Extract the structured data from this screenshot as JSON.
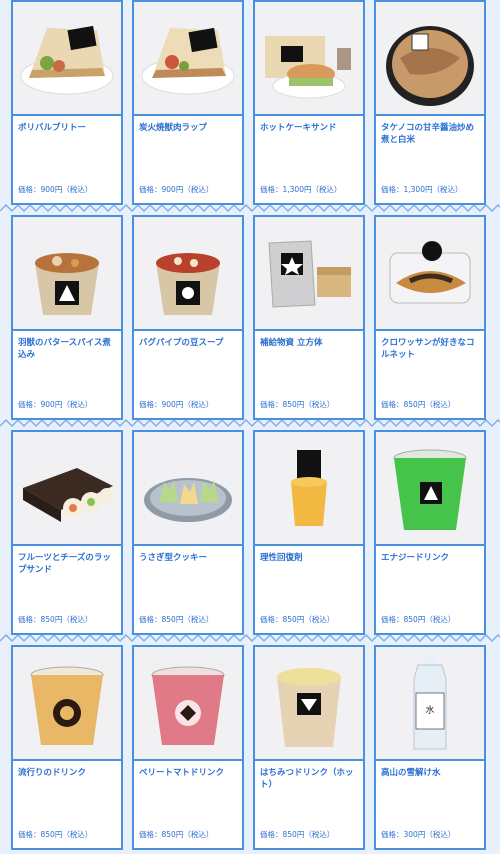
{
  "colors": {
    "accent": "#2b6fd1",
    "border": "#4a8fe0",
    "background": "#e8f0fb"
  },
  "items": [
    {
      "name": "ボリバルブリトー",
      "price": "価格：900円（税込）",
      "icon": "burrito-photo"
    },
    {
      "name": "炭火焼獣肉ラップ",
      "price": "価格：900円（税込）",
      "icon": "wrap-photo"
    },
    {
      "name": "ホットケーキサンド",
      "price": "価格：1,300円（税込）",
      "icon": "pancake-sandwich-photo"
    },
    {
      "name": "タケノコの甘辛醤油炒め煮と白米",
      "price": "価格：1,300円（税込）",
      "icon": "bento-photo"
    },
    {
      "name": "羽獣のバタースパイス煮込み",
      "price": "価格：900円（税込）",
      "icon": "stew-cup-photo"
    },
    {
      "name": "バグパイプの豆スープ",
      "price": "価格：900円（税込）",
      "icon": "soup-cup-photo"
    },
    {
      "name": "補給物資 立方体",
      "price": "価格：850円（税込）",
      "icon": "ration-cube-photo"
    },
    {
      "name": "クロワッサンが好きなコルネット",
      "price": "価格：850円（税込）",
      "icon": "cornet-photo"
    },
    {
      "name": "フルーツとチーズのラップサンド",
      "price": "価格：850円（税込）",
      "icon": "fruit-sandwich-photo"
    },
    {
      "name": "うさぎ型クッキー",
      "price": "価格：850円（税込）",
      "icon": "rabbit-cookie-photo"
    },
    {
      "name": "理性回復剤",
      "price": "価格：850円（税込）",
      "icon": "jelly-photo"
    },
    {
      "name": "エナジードリンク",
      "price": "価格：850円（税込）",
      "icon": "green-drink-photo"
    },
    {
      "name": "流行りのドリンク",
      "price": "価格：850円（税込）",
      "icon": "tea-drink-photo"
    },
    {
      "name": "ベリートマトドリンク",
      "price": "価格：850円（税込）",
      "icon": "berry-drink-photo"
    },
    {
      "name": "はちみつドリンク（ホット）",
      "price": "価格：850円（税込）",
      "icon": "honey-drink-photo"
    },
    {
      "name": "高山の雪解け水",
      "price": "価格：300円（税込）",
      "icon": "water-bottle-photo"
    }
  ]
}
